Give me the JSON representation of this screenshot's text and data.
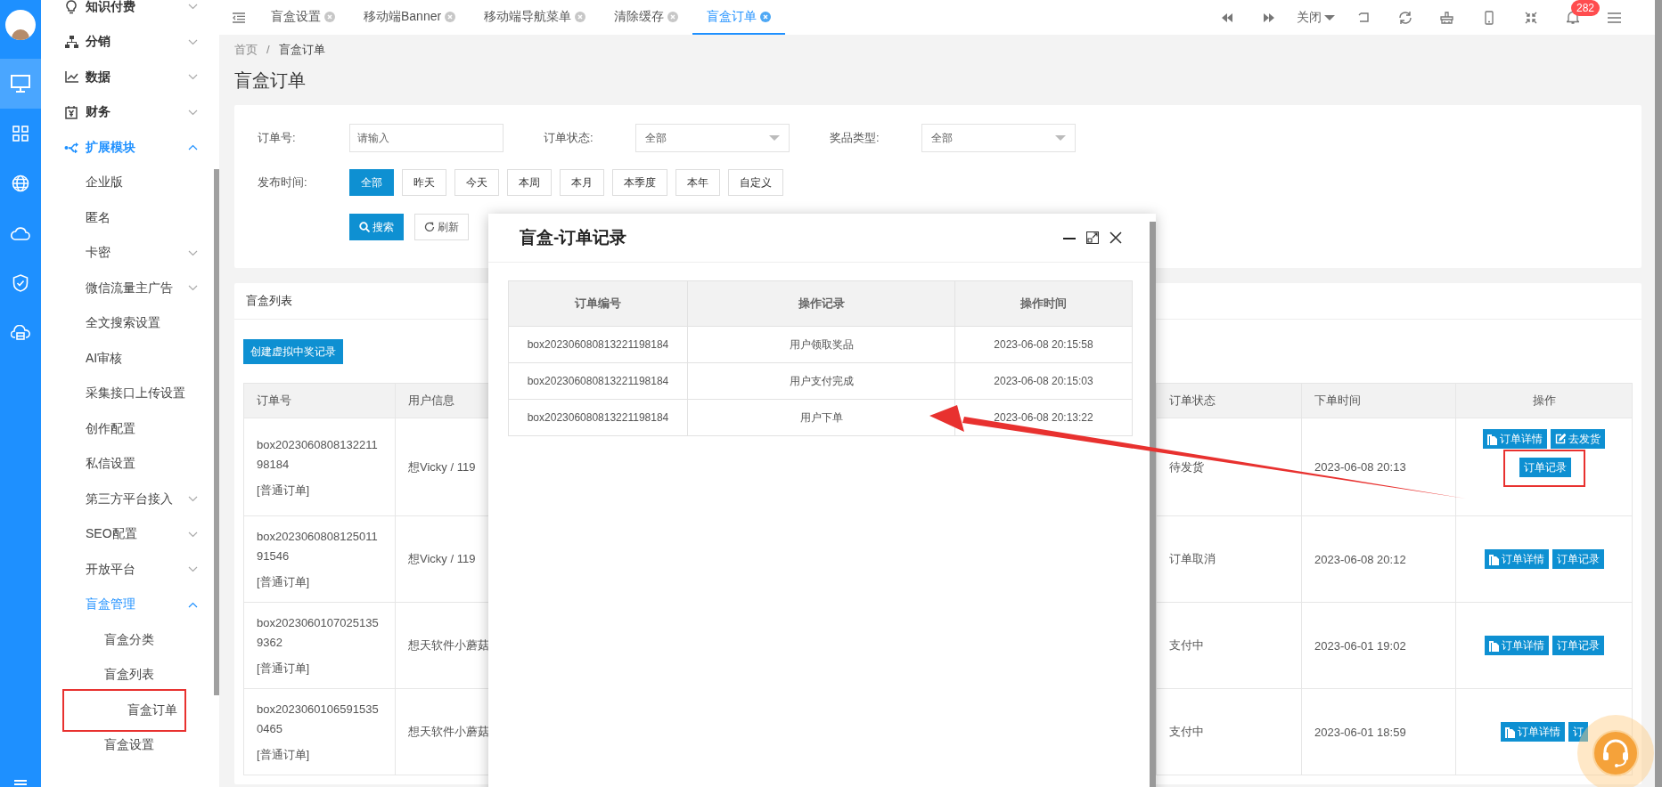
{
  "rail": {
    "items": [
      {
        "kind": "monitor",
        "selected": true
      },
      {
        "kind": "grid",
        "selected": false
      },
      {
        "kind": "globe",
        "selected": false
      },
      {
        "kind": "cloud",
        "selected": false
      },
      {
        "kind": "shield",
        "selected": false
      },
      {
        "kind": "cloud-box",
        "selected": false
      }
    ]
  },
  "sidebar": {
    "items": [
      {
        "label": "知识付费",
        "kind": "bulb",
        "expanded": false
      },
      {
        "label": "分销",
        "kind": "hierarchy",
        "expanded": false
      },
      {
        "label": "数据",
        "kind": "chart",
        "expanded": false
      },
      {
        "label": "财务",
        "kind": "money",
        "expanded": false
      },
      {
        "label": "扩展模块",
        "kind": "share",
        "expanded": true,
        "children": [
          {
            "label": "企业版"
          },
          {
            "label": "匿名"
          },
          {
            "label": "卡密",
            "expanded": false
          },
          {
            "label": "微信流量主广告",
            "expanded": false
          },
          {
            "label": "全文搜索设置"
          },
          {
            "label": "AI审核"
          },
          {
            "label": "采集接口上传设置"
          },
          {
            "label": "创作配置"
          },
          {
            "label": "私信设置"
          },
          {
            "label": "第三方平台接入",
            "expanded": false
          },
          {
            "label": "SEO配置",
            "expanded": false
          },
          {
            "label": "开放平台",
            "expanded": false
          },
          {
            "label": "盲盒管理",
            "expanded": true,
            "children": [
              {
                "label": "盲盒分类",
                "highlighted": false
              },
              {
                "label": "盲盒列表",
                "highlighted": false
              },
              {
                "label": "盲盒订单",
                "highlighted": true
              },
              {
                "label": "盲盒设置",
                "highlighted": false
              }
            ]
          }
        ]
      }
    ]
  },
  "tabs": [
    {
      "label": "盲盒设置",
      "selected": false
    },
    {
      "label": "移动端Banner",
      "selected": false
    },
    {
      "label": "移动端导航菜单",
      "selected": false
    },
    {
      "label": "清除缓存",
      "selected": false
    },
    {
      "label": "盲盒订单",
      "selected": true
    }
  ],
  "toolbar": {
    "close_menu": "关闭",
    "notifications": "282"
  },
  "breadcrumb": {
    "separator": "/",
    "items": [
      "首页",
      "盲盒订单"
    ]
  },
  "page_title": "盲盒订单",
  "filters": {
    "fields": [
      {
        "label": "订单号:",
        "kind": "input",
        "placeholder": "请输入"
      },
      {
        "label": "订单状态:",
        "kind": "select",
        "value": "全部"
      },
      {
        "label": "奖品类型:",
        "kind": "select",
        "value": "全部"
      }
    ],
    "time": {
      "label": "发布时间:",
      "options": [
        {
          "label": "全部",
          "selected": true
        },
        {
          "label": "昨天",
          "selected": false
        },
        {
          "label": "今天",
          "selected": false
        },
        {
          "label": "本周",
          "selected": false
        },
        {
          "label": "本月",
          "selected": false
        },
        {
          "label": "本季度",
          "selected": false
        },
        {
          "label": "本年",
          "selected": false
        },
        {
          "label": "自定义",
          "selected": false
        }
      ]
    },
    "actions": [
      {
        "label": "搜索",
        "kind": "search"
      },
      {
        "label": "刷新",
        "kind": "refresh"
      }
    ]
  },
  "list": {
    "title": "盲盒列表",
    "create_button": "创建虚拟中奖记录",
    "columns": [
      "订单号",
      "用户信息",
      "订单状态",
      "下单时间",
      "操作"
    ],
    "rows": [
      {
        "order_no": "box202306080813221198184",
        "order_type": "[普通订单]",
        "user": "想Vicky / 119",
        "status": "待发货",
        "time": "2023-06-08 20:13",
        "actions": [
          {
            "label": "订单详情",
            "kind": "detail",
            "highlighted": false
          },
          {
            "label": "去发货",
            "kind": "ship",
            "highlighted": false
          },
          {
            "label": "订单记录",
            "kind": "record",
            "highlighted": true
          }
        ]
      },
      {
        "order_no": "box202306080812501191546",
        "order_type": "[普通订单]",
        "user": "想Vicky / 119",
        "status": "订单取消",
        "time": "2023-06-08 20:12",
        "actions": [
          {
            "label": "订单详情",
            "kind": "detail",
            "highlighted": false
          },
          {
            "label": "订单记录",
            "kind": "record",
            "highlighted": false
          }
        ]
      },
      {
        "order_no": "box2023060107025135 9362",
        "order_type": "[普通订单]",
        "user": "想天软件小蘑菇",
        "status": "支付中",
        "time": "2023-06-01 19:02",
        "actions": [
          {
            "label": "订单详情",
            "kind": "detail",
            "highlighted": false
          },
          {
            "label": "订单记录",
            "kind": "record",
            "highlighted": false
          }
        ]
      },
      {
        "order_no": "box2023060106591535 0465",
        "order_type": "[普通订单]",
        "user": "想天软件小蘑菇",
        "status": "支付中",
        "time": "2023-06-01 18:59",
        "actions": [
          {
            "label": "订单详情",
            "kind": "detail",
            "highlighted": false
          },
          {
            "label": "订",
            "kind": "record",
            "highlighted": false
          }
        ]
      }
    ]
  },
  "modal": {
    "title": "盲盒-订单记录",
    "columns": [
      "订单编号",
      "操作记录",
      "操作时间"
    ],
    "rows": [
      [
        "box202306080813221198184",
        "用户领取奖品",
        "2023-06-08 20:15:58"
      ],
      [
        "box202306080813221198184",
        "用户支付完成",
        "2023-06-08 20:15:03"
      ],
      [
        "box202306080813221198184",
        "用户下单",
        "2023-06-08 20:13:22"
      ]
    ]
  }
}
